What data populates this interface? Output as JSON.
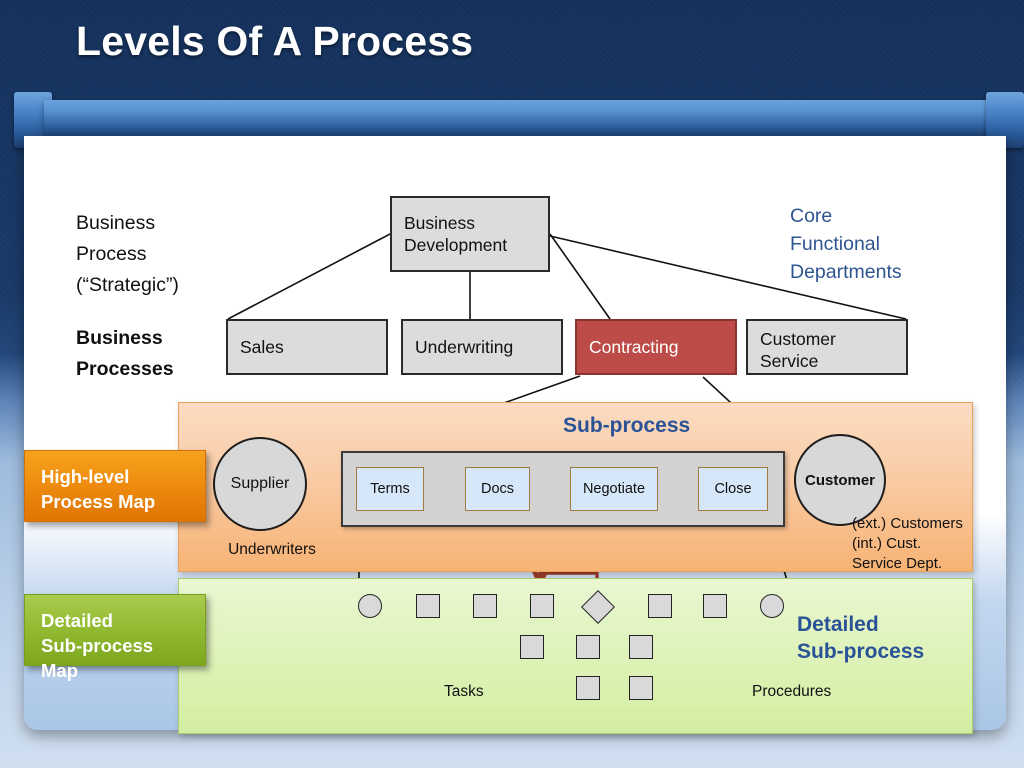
{
  "slide": {
    "title": "Levels Of A Process"
  },
  "left_text": {
    "line1": "Business",
    "line2": "Process",
    "line3": "(“Strategic”)",
    "strong1": "Business",
    "strong2": "Processes"
  },
  "core_departments": {
    "line1": "Core",
    "line2": "Functional",
    "line3": "Departments"
  },
  "departments": {
    "business_development": "Business\nDevelopment",
    "business_development_l1": "Business",
    "business_development_l2": "Development",
    "sales": "Sales",
    "underwriting": "Underwriting",
    "contracting": "Contracting",
    "customer_service_l1": "Customer",
    "customer_service_l2": "Service"
  },
  "callouts": {
    "high_level_l1": "High-level",
    "high_level_l2": "Process Map",
    "detailed_l1": "Detailed",
    "detailed_l2": "Sub-process Map"
  },
  "subprocess_band": {
    "heading": "Sub-process",
    "supplier": "Supplier",
    "supplier_note": "Underwriters",
    "customer": "Customer",
    "customer_note_l1": "(ext.) Customers",
    "customer_note_l2": "(int.) Cust.",
    "customer_note_l3": "Service Dept.",
    "steps": [
      "Terms",
      "Docs",
      "Negotiate",
      "Close"
    ]
  },
  "detailed_band": {
    "heading_l1": "Detailed",
    "heading_l2": "Sub-process",
    "tasks_label": "Tasks",
    "procedures_label": "Procedures"
  },
  "colors": {
    "title_text": "#ffffff",
    "slide_dark_blue": "#15315c",
    "accent_blue": "#2a5296",
    "dept_gray": "#dcdcdc",
    "dept_red": "#bd4b48",
    "band_orange": "#f9cba5",
    "band_green": "#dff3bb",
    "callout_orange": "#ef8d10",
    "callout_green": "#93bb33",
    "flow_arrow": "#a03c2c",
    "step_blue": "#d5e7f8"
  }
}
